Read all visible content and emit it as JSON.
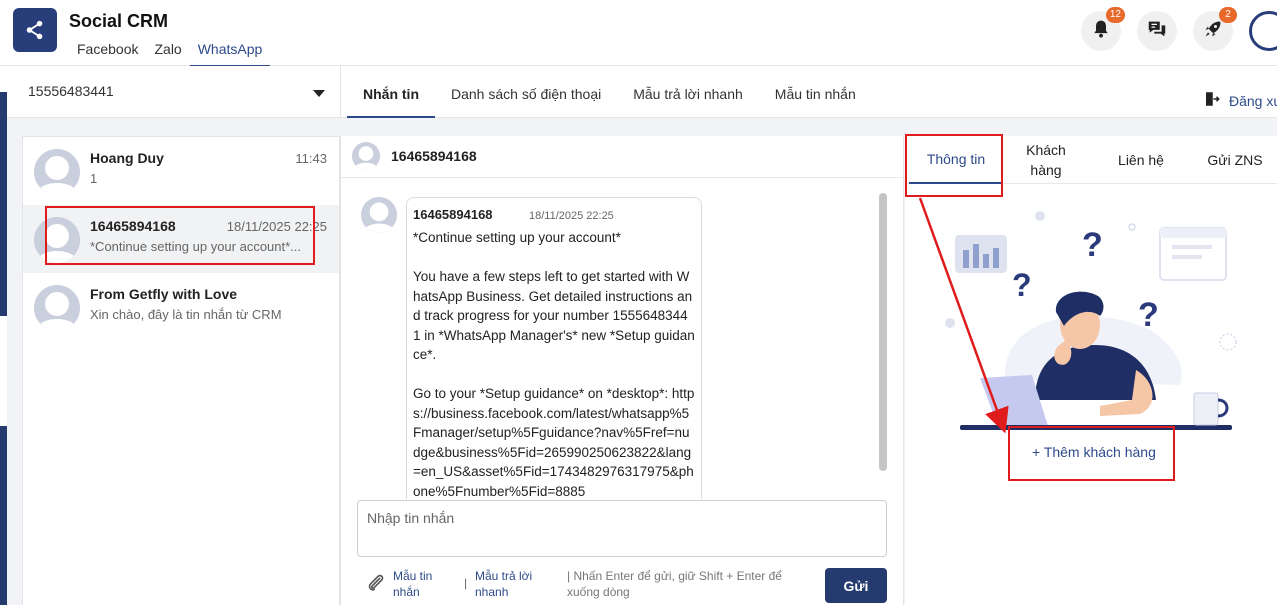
{
  "header": {
    "app_title": "Social CRM",
    "channels": [
      "Facebook",
      "Zalo",
      "WhatsApp"
    ],
    "active_channel": "WhatsApp",
    "notifications_count": "12",
    "rocket_count": "2"
  },
  "subheader": {
    "account_number": "15556483441",
    "tabs": [
      "Nhắn tin",
      "Danh sách số điện thoại",
      "Mẫu trả lời nhanh",
      "Mẫu tin nhắn"
    ],
    "active_tab": "Nhắn tin",
    "logout_label": "Đăng xuất"
  },
  "conversations": [
    {
      "name": "Hoang Duy",
      "time": "11:43",
      "preview": "1"
    },
    {
      "name": "16465894168",
      "time": "18/11/2025 22:25",
      "preview": "*Continue setting up your account*..."
    },
    {
      "name": "From Getfly with Love",
      "time": "",
      "preview": "Xin chào, đây là tin nhắn từ CRM"
    }
  ],
  "chat": {
    "contact_name": "16465894168",
    "message": {
      "sender": "16465894168",
      "time": "18/11/2025 22:25",
      "text": "*Continue setting up your account*\n\nYou have a few steps left to get started with WhatsApp Business. Get detailed instructions and track progress for your number 15556483441 in *WhatsApp Manager's* new *Setup guidance*.\n\nGo to your *Setup guidance* on *desktop*: https://business.facebook.com/latest/whatsapp%5Fmanager/setup%5Fguidance?nav%5Fref=nudge&business%5Fid=265990250623822&lang=en_US&asset%5Fid=1743482976317975&phone%5Fnumber%5Fid=8885"
    },
    "input_placeholder": "Nhập tin nhắn",
    "template_link": "Mẫu tin nhắn",
    "quick_reply_link": "Mẫu trả lời nhanh",
    "hint": "| Nhấn Enter để gửi, giữ Shift + Enter để xuống dòng",
    "send_label": "Gửi"
  },
  "right_panel": {
    "tabs": [
      "Thông tin",
      "Khách hàng",
      "Liên hệ",
      "Gửi ZNS"
    ],
    "active_tab": "Thông tin",
    "add_customer_label": "+ Thêm khách hàng"
  },
  "colors": {
    "brand": "#253a6e",
    "accent_link": "#2d4a8a",
    "badge": "#e8692c",
    "annotation": "#e01b1b"
  },
  "icons": [
    "share-icon",
    "bell-icon",
    "chat-bubbles-icon",
    "rocket-icon",
    "caret-down-icon",
    "logout-icon",
    "paperclip-icon",
    "avatar-placeholder-icon"
  ]
}
